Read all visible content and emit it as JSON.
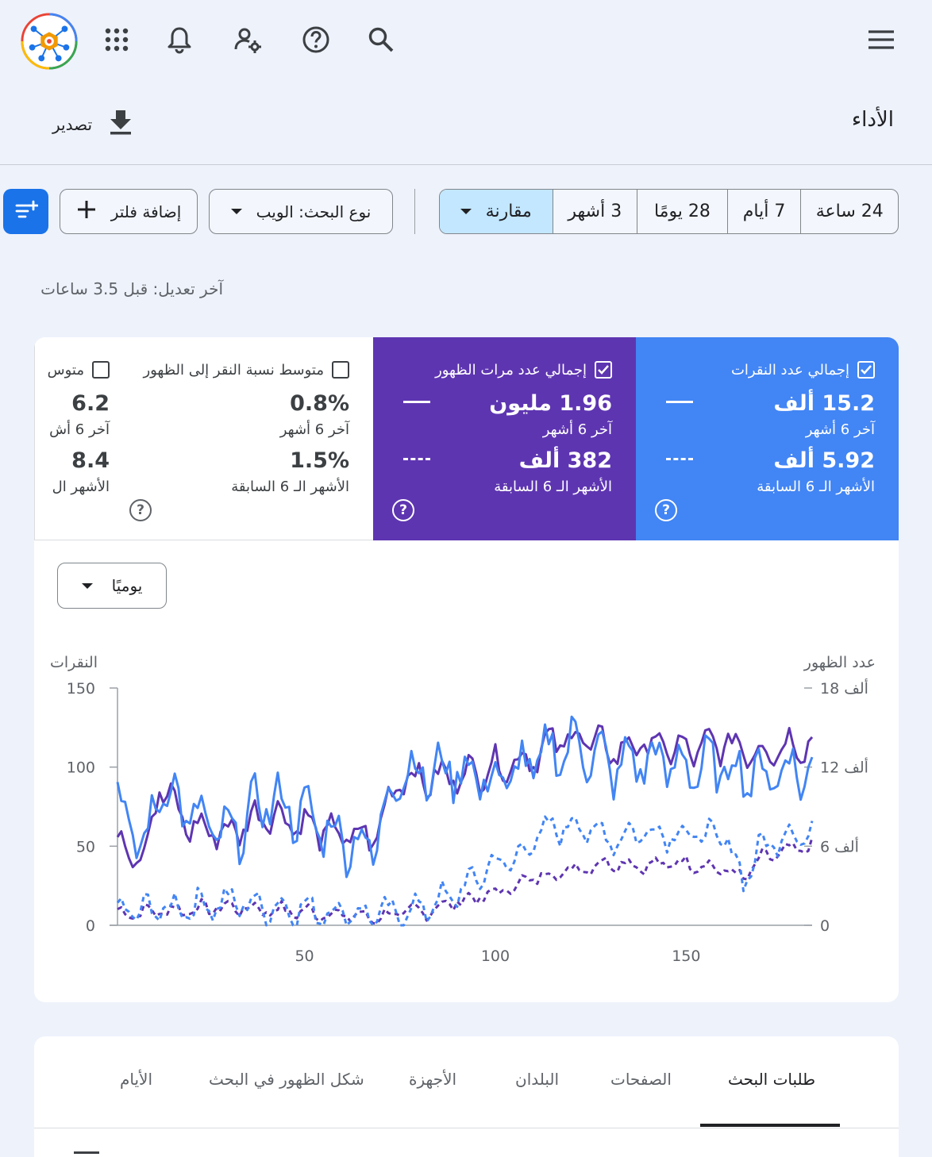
{
  "colors": {
    "clicks": "#4285f4",
    "impressions": "#5e35b1",
    "accent": "#1a73e8",
    "selected_chip": "#c2e7ff"
  },
  "header": {
    "title": "الأداء",
    "export_label": "تصدير"
  },
  "icons": {
    "logo": "app-logo-icon",
    "apps": "apps-grid-icon",
    "bell": "bell-icon",
    "users": "manage-users-icon",
    "help": "help-icon",
    "search": "search-icon",
    "menu": "menu-icon",
    "download": "download-icon"
  },
  "date_range": {
    "options": [
      "24 ساعة",
      "7 أيام",
      "28 يومًا",
      "3 أشهر"
    ],
    "compare_label": "مقارنة"
  },
  "filters": {
    "search_type_label": "نوع البحث: الويب",
    "add_filter_label": "إضافة فلتر"
  },
  "last_update": "آخر تعديل: قبل 3.5 ساعات",
  "metrics": [
    {
      "title": "إجمالي عدد النقرات",
      "checked": true,
      "value": "15.2 ألف",
      "period": "آخر 6 أشهر",
      "compare_value": "5.92 ألف",
      "compare_period": "الأشهر الـ 6 السابقة",
      "color": "#4285f4"
    },
    {
      "title": "إجمالي عدد مرات الظهور",
      "checked": true,
      "value": "1.96 مليون",
      "period": "آخر 6 أشهر",
      "compare_value": "382 ألف",
      "compare_period": "الأشهر الـ 6 السابقة",
      "color": "#5e35b1"
    },
    {
      "title": "متوسط نسبة النقر إلى الظهور",
      "checked": false,
      "value": "0.8%",
      "period": "آخر 6 أشهر",
      "compare_value": "1.5%",
      "compare_period": "الأشهر الـ 6 السابقة"
    },
    {
      "title": "متوس",
      "checked": false,
      "value": "6.2",
      "period": "آخر 6 أش",
      "compare_value": "8.4",
      "compare_period": "الأشهر ال"
    }
  ],
  "granularity": "يوميًا",
  "chart_data": {
    "type": "line",
    "ylabel_left": "النقرات",
    "ylabel_right": "عدد الظهور",
    "y_left_ticks": [
      "150",
      "100",
      "50",
      "0"
    ],
    "y_right_ticks": [
      "18 ألف",
      "12 ألف",
      "6 ألف",
      "0"
    ],
    "x_ticks": [
      "50",
      "100",
      "150"
    ],
    "ylim_left": [
      0,
      150
    ],
    "ylim_right": [
      0,
      18000
    ],
    "xlim": [
      1,
      183
    ],
    "series_keyframes": {
      "clicks_current": [
        [
          1,
          80
        ],
        [
          8,
          45
        ],
        [
          12,
          90
        ],
        [
          20,
          70
        ],
        [
          30,
          55
        ],
        [
          40,
          80
        ],
        [
          50,
          70
        ],
        [
          60,
          55
        ],
        [
          68,
          50
        ],
        [
          75,
          100
        ],
        [
          82,
          95
        ],
        [
          90,
          100
        ],
        [
          100,
          90
        ],
        [
          108,
          100
        ],
        [
          115,
          110
        ],
        [
          122,
          115
        ],
        [
          130,
          100
        ],
        [
          140,
          105
        ],
        [
          150,
          100
        ],
        [
          160,
          100
        ],
        [
          170,
          95
        ],
        [
          178,
          100
        ],
        [
          183,
          95
        ]
      ],
      "impressions_current": [
        [
          1,
          6600
        ],
        [
          8,
          5400
        ],
        [
          12,
          10500
        ],
        [
          20,
          7500
        ],
        [
          30,
          7000
        ],
        [
          40,
          8600
        ],
        [
          50,
          7600
        ],
        [
          60,
          6800
        ],
        [
          68,
          6600
        ],
        [
          75,
          11400
        ],
        [
          82,
          11000
        ],
        [
          90,
          11400
        ],
        [
          100,
          12000
        ],
        [
          108,
          12600
        ],
        [
          115,
          13800
        ],
        [
          122,
          14400
        ],
        [
          130,
          13200
        ],
        [
          140,
          13800
        ],
        [
          150,
          13200
        ],
        [
          160,
          13800
        ],
        [
          170,
          13200
        ],
        [
          178,
          13800
        ],
        [
          183,
          13800
        ]
      ],
      "clicks_previous": [
        [
          1,
          8
        ],
        [
          20,
          12
        ],
        [
          30,
          15
        ],
        [
          40,
          12
        ],
        [
          50,
          10
        ],
        [
          60,
          8
        ],
        [
          68,
          6
        ],
        [
          75,
          8
        ],
        [
          82,
          12
        ],
        [
          90,
          20
        ],
        [
          100,
          40
        ],
        [
          105,
          40
        ],
        [
          110,
          55
        ],
        [
          120,
          65
        ],
        [
          130,
          55
        ],
        [
          140,
          60
        ],
        [
          150,
          58
        ],
        [
          160,
          55
        ],
        [
          165,
          30
        ],
        [
          170,
          50
        ],
        [
          178,
          60
        ],
        [
          183,
          55
        ]
      ],
      "impressions_previous": [
        [
          1,
          900
        ],
        [
          20,
          1200
        ],
        [
          30,
          1400
        ],
        [
          40,
          1200
        ],
        [
          50,
          1000
        ],
        [
          60,
          800
        ],
        [
          68,
          600
        ],
        [
          75,
          900
        ],
        [
          82,
          1100
        ],
        [
          90,
          1800
        ],
        [
          100,
          2400
        ],
        [
          110,
          3600
        ],
        [
          120,
          4200
        ],
        [
          130,
          4800
        ],
        [
          140,
          4500
        ],
        [
          150,
          4800
        ],
        [
          160,
          4200
        ],
        [
          165,
          3600
        ],
        [
          170,
          5100
        ],
        [
          178,
          5700
        ],
        [
          183,
          6000
        ]
      ]
    }
  },
  "tabs": [
    {
      "label": "طلبات البحث",
      "active": true
    },
    {
      "label": "الصفحات",
      "active": false
    },
    {
      "label": "البلدان",
      "active": false
    },
    {
      "label": "الأجهزة",
      "active": false
    },
    {
      "label": "شكل الظهور في البحث",
      "active": false
    },
    {
      "label": "الأيام",
      "active": false
    }
  ]
}
